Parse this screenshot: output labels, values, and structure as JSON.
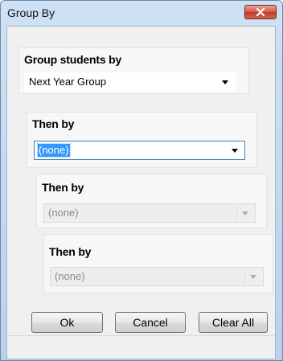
{
  "window": {
    "title": "Group By"
  },
  "panels": [
    {
      "label": "Group students by",
      "value": "Next Year Group",
      "state": "normal"
    },
    {
      "label": "Then by",
      "value": "(none)",
      "state": "focused"
    },
    {
      "label": "Then by",
      "value": "(none)",
      "state": "disabled"
    },
    {
      "label": "Then by",
      "value": "(none)",
      "state": "disabled"
    }
  ],
  "buttons": {
    "ok": "Ok",
    "cancel": "Cancel",
    "clear_all": "Clear All"
  },
  "icons": {
    "close": "close-icon",
    "dropdown": "chevron-down-icon"
  },
  "colors": {
    "close_button": "#c8473a",
    "selection": "#3399ff",
    "title_bar": "#c4daf2"
  }
}
